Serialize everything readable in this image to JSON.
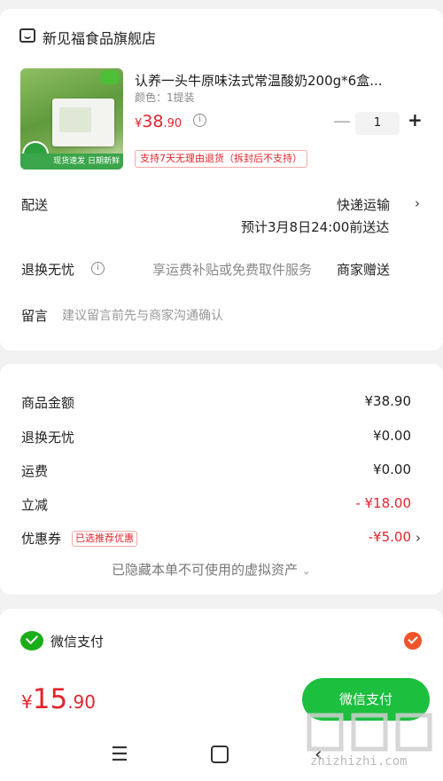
{
  "shop": {
    "name": "新见福食品旗舰店"
  },
  "product": {
    "title": "认养一头牛原味法式常温酸奶200g*6盒...",
    "spec": "颜色：1提装",
    "price_symbol": "¥",
    "price_int": "38",
    "price_dec": ".90",
    "quantity": "1",
    "return_tag": "支持7天无理由退货（拆封后不支持）",
    "image_ribbon": "现货速发 日期新鲜"
  },
  "delivery": {
    "label": "配送",
    "method": "快递运输",
    "estimate": "预计3月8日24:00前送达"
  },
  "return_service": {
    "label": "退换无忧",
    "description": "享运费补贴或免费取件服务",
    "value": "商家赠送"
  },
  "message": {
    "label": "留言",
    "placeholder": "建议留言前先与商家沟通确认"
  },
  "prices": {
    "items": [
      {
        "label": "商品金额",
        "value": "¥38.90"
      },
      {
        "label": "退换无忧",
        "value": "¥0.00"
      },
      {
        "label": "运费",
        "value": "¥0.00"
      },
      {
        "label": "立减",
        "value": "- ¥18.00"
      },
      {
        "label": "优惠券",
        "tag": "已选推荐优惠",
        "value": "-¥5.00"
      }
    ],
    "hidden_assets": "已隐藏本单不可使用的虚拟资产"
  },
  "payment": {
    "method": "微信支付",
    "total_symbol": "¥",
    "total_int": "15",
    "total_dec": ".90",
    "button": "微信支付"
  },
  "watermark": {
    "url": "zhizhizhi.com"
  },
  "colors": {
    "accent_red": "#e3242b",
    "wechat_green": "#1dbf3e",
    "check_orange": "#f0542b"
  }
}
